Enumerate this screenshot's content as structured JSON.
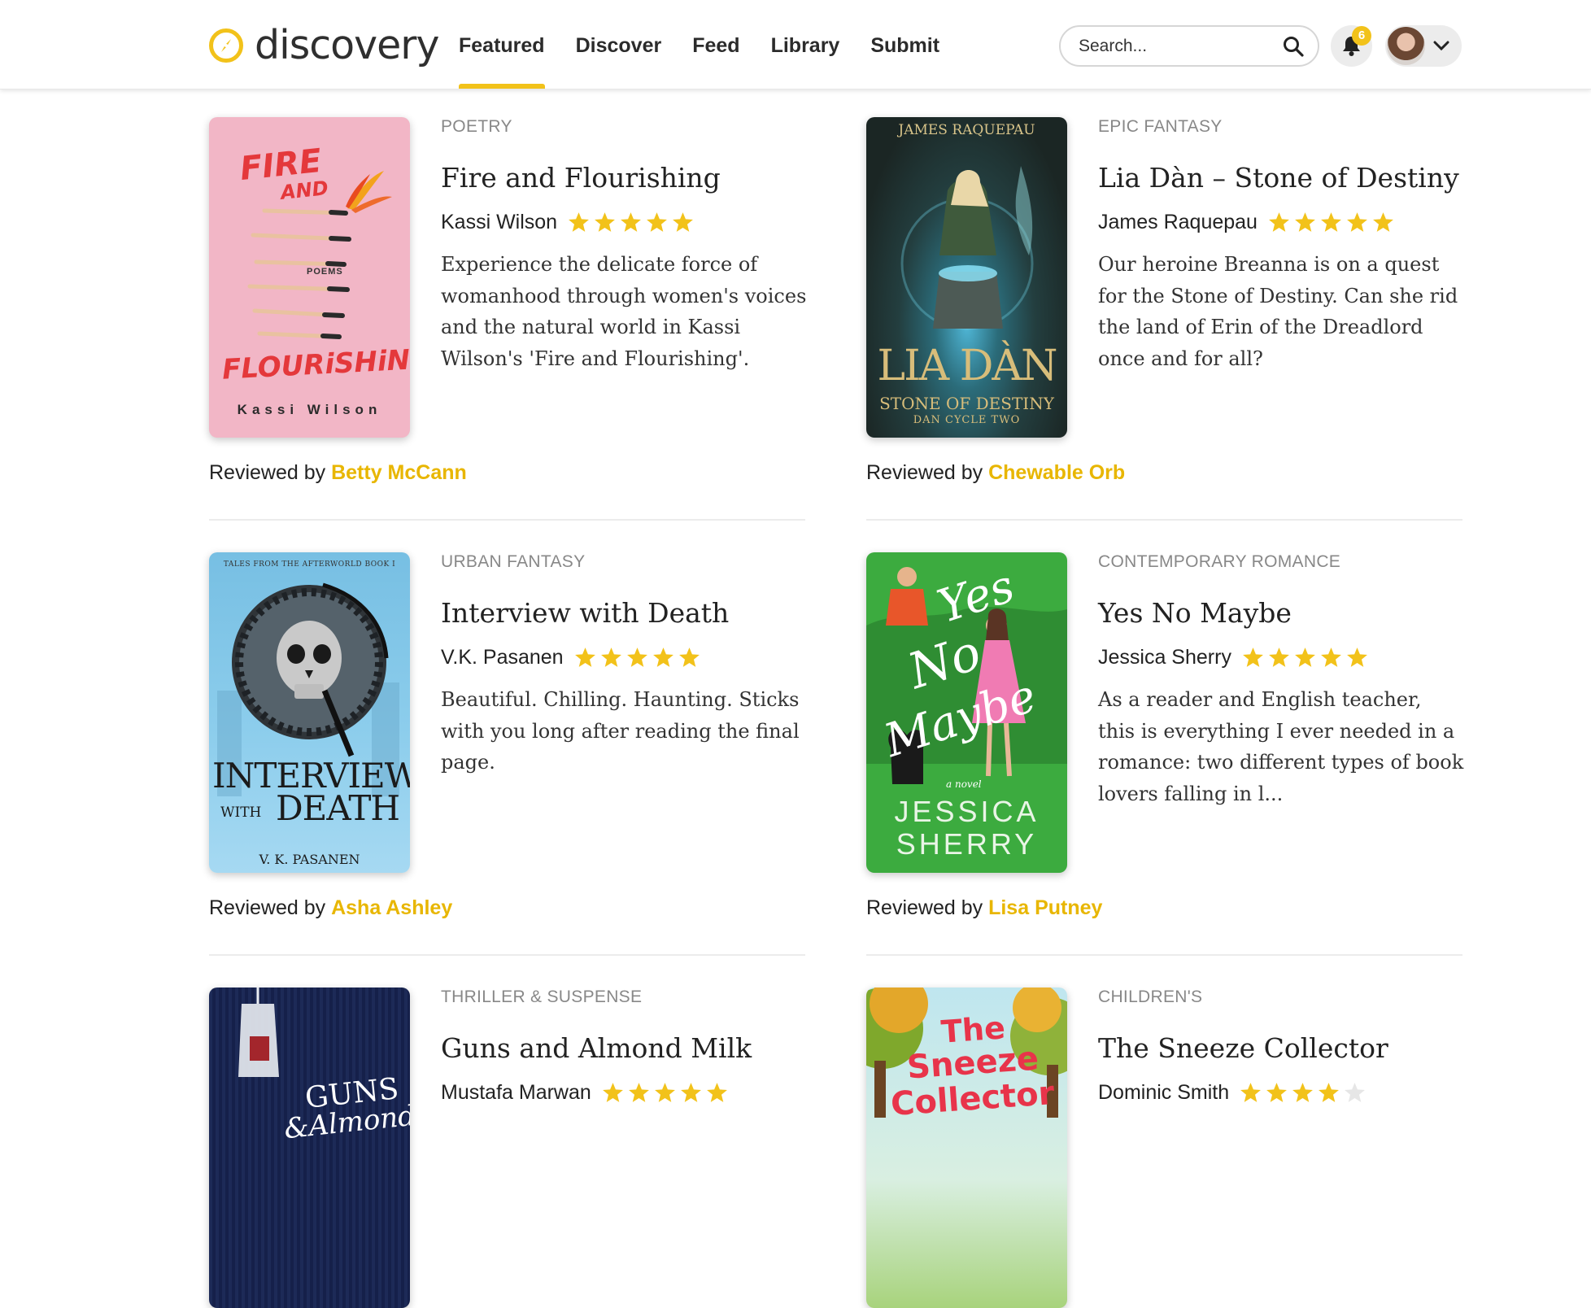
{
  "header": {
    "logo_text": "discovery",
    "nav": [
      {
        "label": "Featured",
        "active": true
      },
      {
        "label": "Discover",
        "active": false
      },
      {
        "label": "Feed",
        "active": false
      },
      {
        "label": "Library",
        "active": false
      },
      {
        "label": "Submit",
        "active": false
      }
    ],
    "search_placeholder": "Search...",
    "notification_count": "6"
  },
  "colors": {
    "accent": "#f2c21a",
    "reviewer": "#e8b600",
    "star": "#f2c21a",
    "star_empty": "#e6e6e6"
  },
  "reviewed_by_label": "Reviewed by",
  "books": [
    {
      "genre": "POETRY",
      "title": "Fire and Flourishing",
      "author": "Kassi Wilson",
      "rating": 5,
      "description": "Experience the delicate force of womanhood through women's voices and the natural world in Kassi Wilson's 'Fire and Flourishing'.",
      "reviewer": "Betty McCann",
      "cover_text": {
        "top": "FIRE",
        "mid": "AND",
        "small": "POEMS",
        "bottom": "FLOURiSHiNG",
        "author": "Kassi Wilson"
      }
    },
    {
      "genre": "EPIC FANTASY",
      "title": "Lia Dàn – Stone of Destiny",
      "author": "James Raquepau",
      "rating": 5,
      "description": "Our heroine Breanna is on a quest for the Stone of Destiny. Can she rid the land of Erin of the Dreadlord once and for all?",
      "reviewer": "Chewable Orb",
      "cover_text": {
        "author": "JAMES RAQUEPAU",
        "title": "LIA DÀN",
        "subtitle": "STONE OF DESTINY",
        "series": "DAN CYCLE TWO"
      }
    },
    {
      "genre": "URBAN FANTASY",
      "title": "Interview with Death",
      "author": "V.K. Pasanen",
      "rating": 5,
      "description": "Beautiful. Chilling. Haunting. Sticks with you long after reading the final page.",
      "reviewer": "Asha Ashley",
      "cover_text": {
        "series": "TALES FROM THE AFTERWORLD BOOK I",
        "title1": "INTERVIEW",
        "with": "WITH",
        "title2": "DEATH",
        "author": "V. K. PASANEN"
      }
    },
    {
      "genre": "CONTEMPORARY ROMANCE",
      "title": "Yes No Maybe",
      "author": "Jessica Sherry",
      "rating": 5,
      "description": "As a reader and English teacher, this is everything I ever needed in a romance: two different types of book lovers falling in l...",
      "reviewer": "Lisa Putney",
      "cover_text": {
        "w1": "Yes",
        "w2": "No",
        "w3": "Maybe",
        "novel": "a novel",
        "first": "JESSICA",
        "last": "SHERRY"
      }
    },
    {
      "genre": "THRILLER & SUSPENSE",
      "title": "Guns and Almond Milk",
      "author": "Mustafa Marwan",
      "rating": 5,
      "cover_text": {
        "line1": "GUNS",
        "line2": "&Almond"
      }
    },
    {
      "genre": "CHILDREN'S",
      "title": "The Sneeze Collector",
      "author": "Dominic Smith",
      "rating": 4,
      "cover_text": {
        "line1": "The",
        "line2": "Sneeze",
        "line3": "Collector"
      }
    }
  ]
}
